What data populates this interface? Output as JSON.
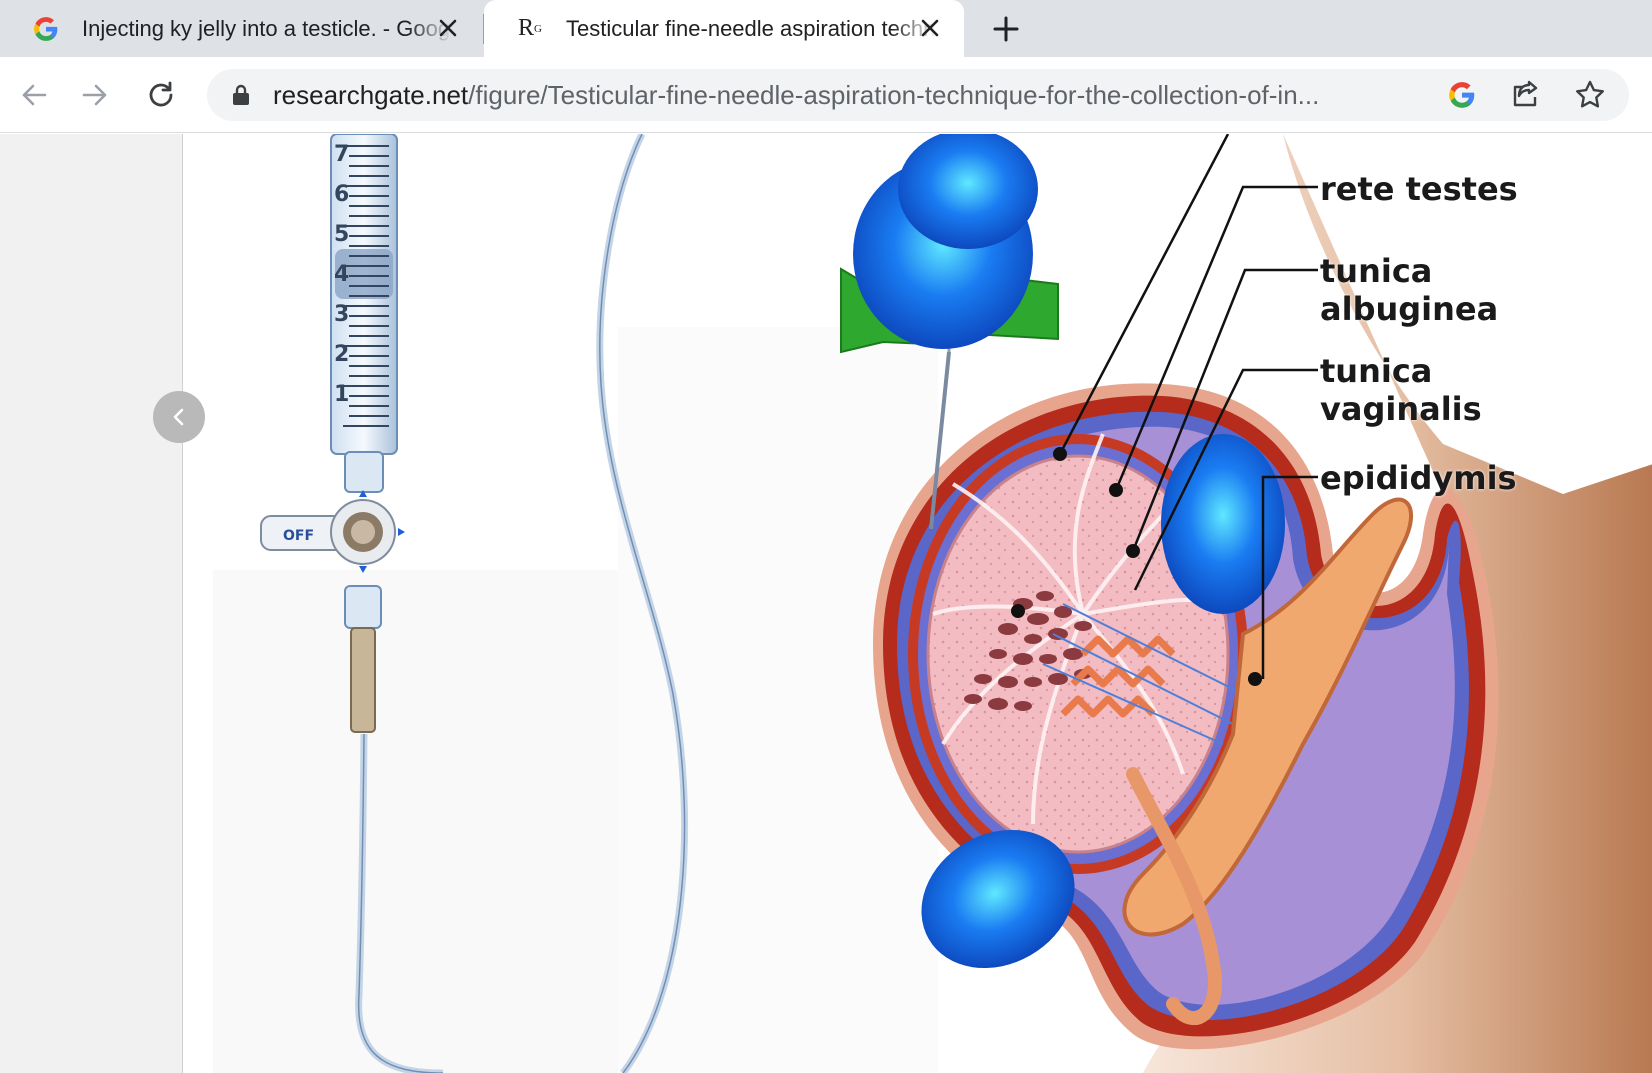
{
  "tabs": [
    {
      "title": "Injecting ky jelly into a testicle. - Google Search",
      "favicon": "google-g-icon",
      "active": false
    },
    {
      "title": "Testicular fine-needle aspiration technique",
      "favicon": "researchgate-icon",
      "favicon_text": "R",
      "favicon_sup": "G",
      "active": true
    }
  ],
  "toolbar": {
    "url_domain": "researchgate.net",
    "url_path": "/figure/Testicular-fine-needle-aspiration-technique-for-the-collection-of-in...",
    "icons": [
      "back-arrow-icon",
      "forward-arrow-icon",
      "reload-icon",
      "lock-icon",
      "google-lens-icon",
      "share-icon",
      "bookmark-star-icon"
    ]
  },
  "figure": {
    "labels": {
      "rete_testes": "rete testes",
      "tunica_albuginea_1": "tunica",
      "tunica_albuginea_2": "albuginea",
      "tunica_vaginalis_1": "tunica",
      "tunica_vaginalis_2": "vaginalis",
      "epididymis": "epididymis"
    },
    "stopcock_text": "OFF",
    "syringe_marks": [
      "7",
      "6",
      "5",
      "4",
      "3",
      "2",
      "1"
    ]
  },
  "colors": {
    "tabbar": "#dee1e6",
    "testis_tissue": "#f0b7bd",
    "tunica_red": "#c8321e",
    "glove_blue": "#1e6ef0",
    "needle_hub_green": "#2ea82e",
    "skin": "#d9a27e"
  }
}
